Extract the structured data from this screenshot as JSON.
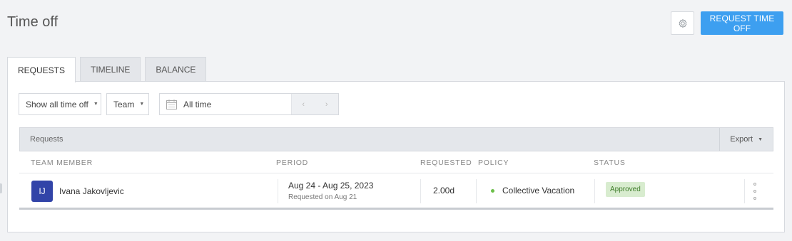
{
  "page": {
    "title": "Time off"
  },
  "header": {
    "settings_icon": "gear-icon",
    "request_button_label": "REQUEST TIME OFF",
    "accent_color": "#3d9ff0"
  },
  "tabs": [
    {
      "label": "REQUESTS",
      "active": true
    },
    {
      "label": "TIMELINE",
      "active": false
    },
    {
      "label": "BALANCE",
      "active": false
    }
  ],
  "filters": {
    "type_filter": "Show all time off",
    "group_filter": "Team",
    "date_range": "All time",
    "calendar_icon": "calendar-icon",
    "prev_icon": "chevron-left-icon",
    "next_icon": "chevron-right-icon"
  },
  "table": {
    "title": "Requests",
    "export_label": "Export",
    "columns": [
      "TEAM MEMBER",
      "PERIOD",
      "REQUESTED",
      "POLICY",
      "STATUS"
    ],
    "rows": [
      {
        "avatar_initials": "IJ",
        "avatar_color": "#3244a8",
        "member": "Ivana Jakovljevic",
        "period": "Aug 24 - Aug 25, 2023",
        "requested_on": "Requested on Aug 21",
        "requested": "2.00d",
        "policy": "Collective Vacation",
        "status": "Approved",
        "status_color": "#3f7d2a"
      }
    ]
  }
}
